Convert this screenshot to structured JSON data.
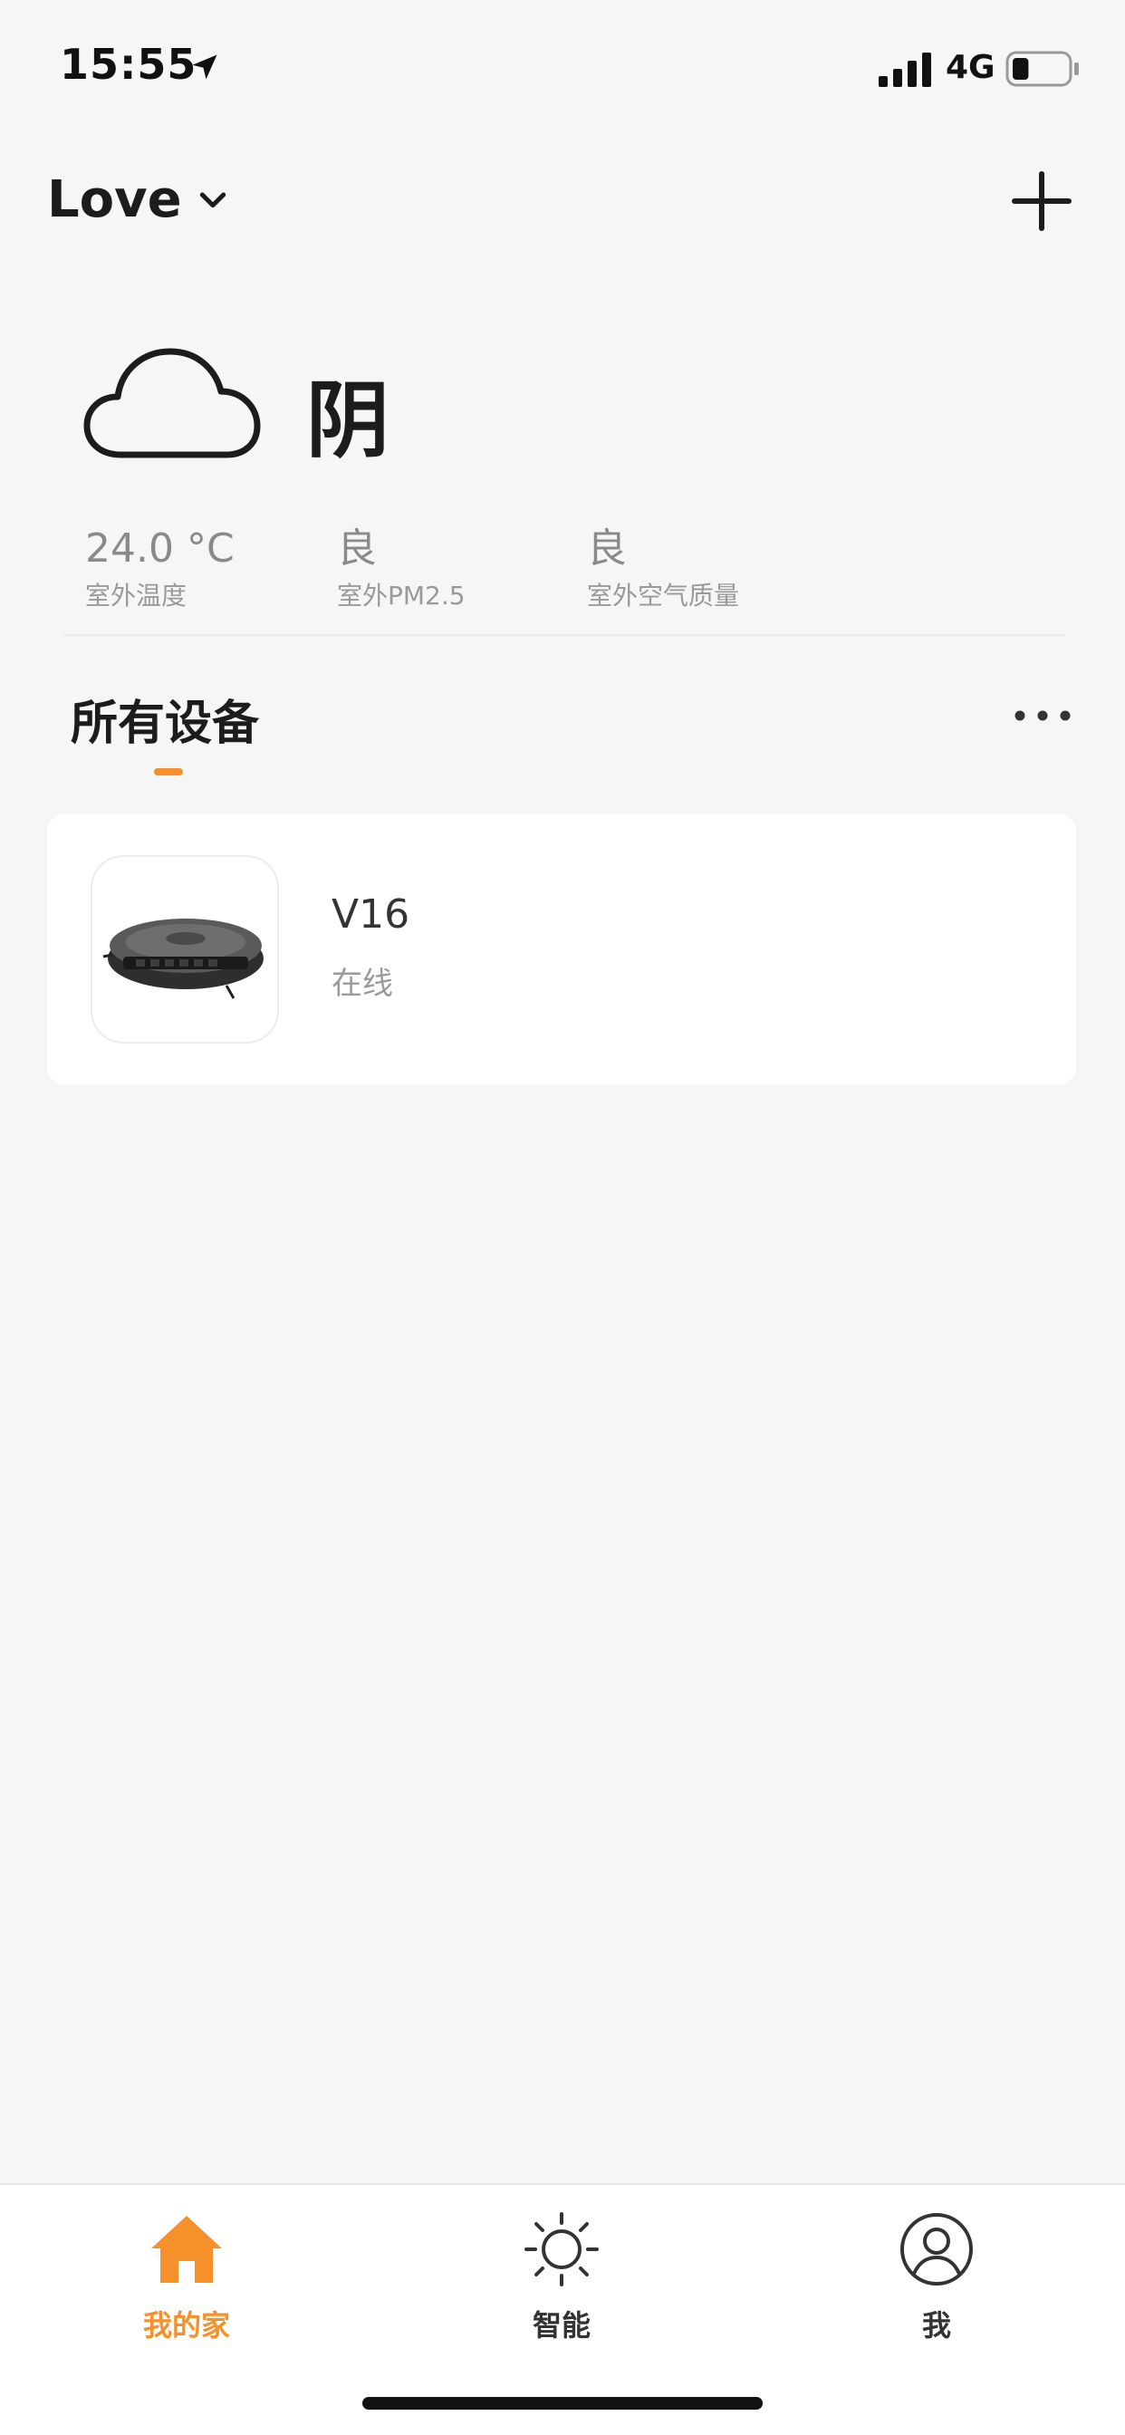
{
  "status_bar": {
    "time": "15:55",
    "network": "4G",
    "battery_level": 0.3,
    "location_icon": "location-arrow-icon",
    "signal_icon": "cellular-signal-icon",
    "battery_icon": "battery-icon"
  },
  "header": {
    "home_name": "Love",
    "dropdown_icon": "chevron-down-icon",
    "add_icon": "plus-icon"
  },
  "weather": {
    "icon": "cloud-icon",
    "condition": "阴",
    "stats": [
      {
        "value": "24.0 °C",
        "label": "室外温度"
      },
      {
        "value": "良",
        "label": "室外PM2.5"
      },
      {
        "value": "良",
        "label": "室外空气质量"
      }
    ]
  },
  "devices_section": {
    "title": "所有设备",
    "more_icon": "more-horizontal-icon",
    "devices": [
      {
        "name": "V16",
        "status": "在线",
        "icon": "robot-vacuum-icon"
      }
    ]
  },
  "tab_bar": {
    "tabs": [
      {
        "label": "我的家",
        "icon": "home-icon",
        "active": true
      },
      {
        "label": "智能",
        "icon": "sun-icon",
        "active": false
      },
      {
        "label": "我",
        "icon": "user-icon",
        "active": false
      }
    ]
  },
  "colors": {
    "accent": "#f5902a",
    "background": "#f6f6f6",
    "card": "#ffffff",
    "text_primary": "#1c1c1c",
    "text_secondary": "#9a9a9a",
    "tab_inactive": "#333333"
  }
}
